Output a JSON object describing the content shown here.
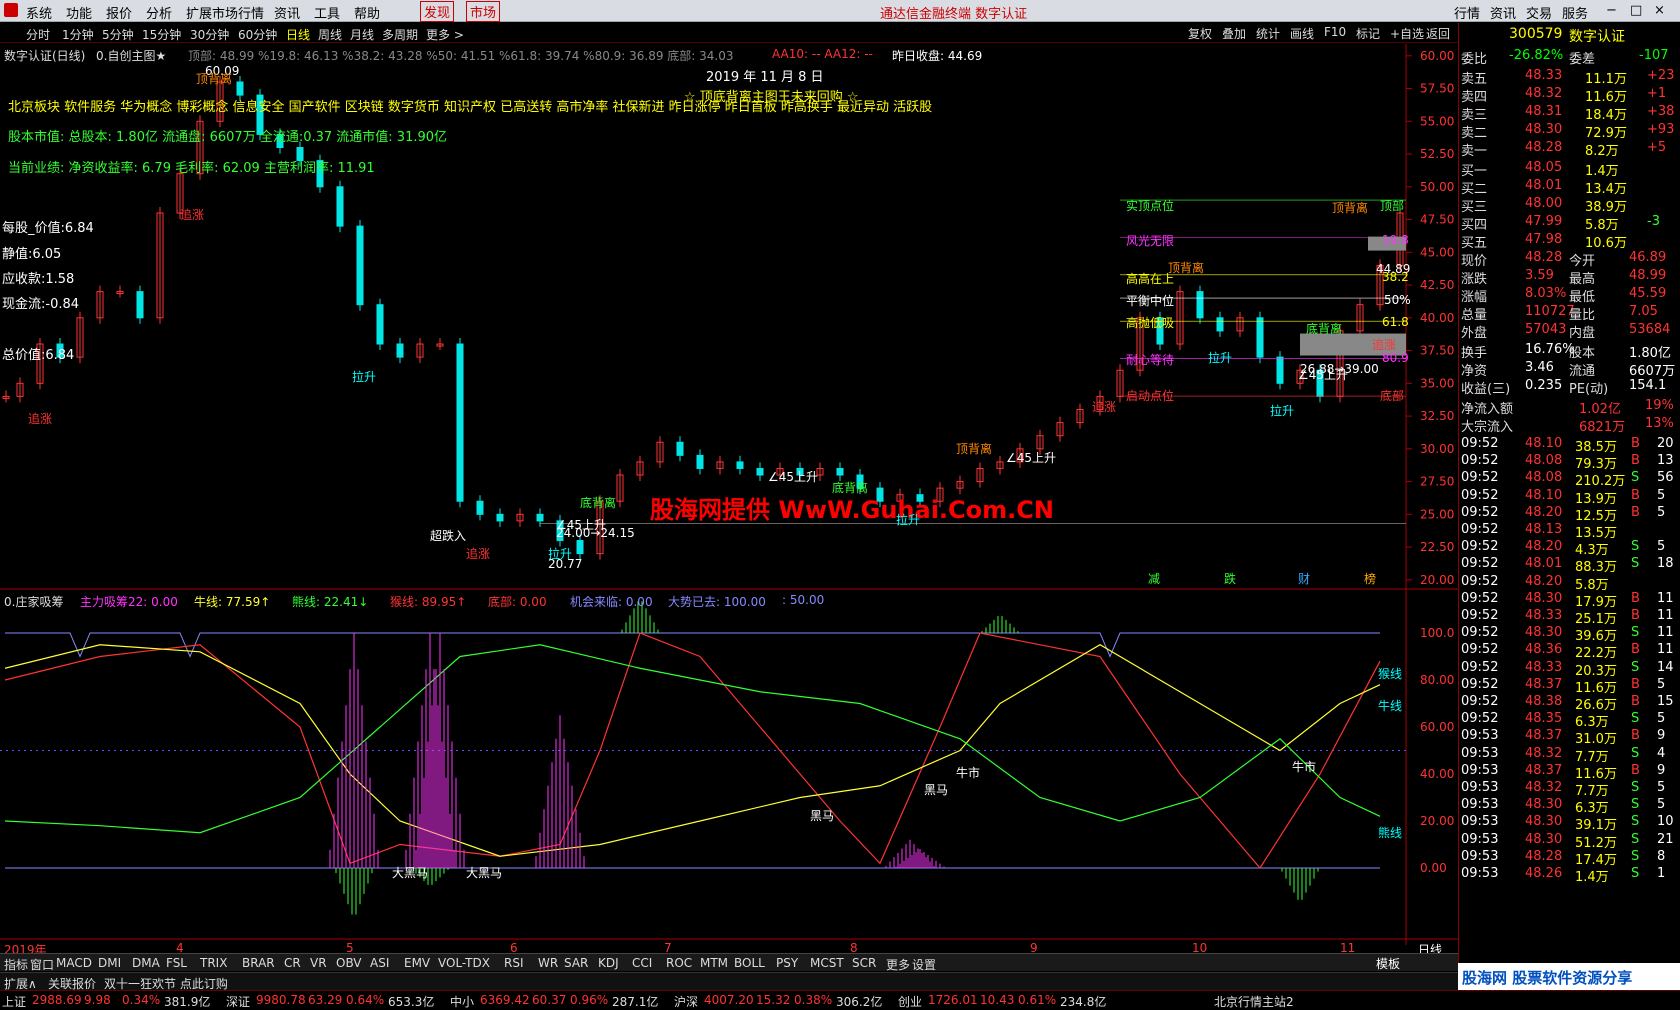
{
  "menu": {
    "items": [
      "系统",
      "功能",
      "报价",
      "分析",
      "扩展市场行情",
      "资讯",
      "工具",
      "帮助"
    ],
    "discover": "发现",
    "market": "市场",
    "center_text": "通达信金融终端  数字认证",
    "right": [
      "行情",
      "资讯",
      "交易",
      "服务"
    ]
  },
  "periods": [
    "分时",
    "1分钟",
    "5分钟",
    "15分钟",
    "30分钟",
    "60分钟",
    "日线",
    "周线",
    "月线",
    "多周期",
    "更多 >"
  ],
  "right_tools": [
    "复权",
    "叠加",
    "统计",
    "画线",
    "F10",
    "标记",
    "+自选",
    "返回"
  ],
  "main_title": "数字认证(日线)",
  "indicator_name": "0.自创主图★",
  "indicator_values": "顶部: 48.99  %19.8: 46.13  %38.2: 43.28  %50: 41.51  %61.8: 39.74  %80.9: 36.89  底部: 34.03",
  "aa_values": "AA10: -- AA12: --",
  "prev_close": "昨日收盘: 44.69",
  "overlay": {
    "date": "2019 年 11 月 8 日",
    "banner": "☆ 顶底背离主图王未来回购 ☆",
    "concepts": "北京板块 软件服务 华为概念 博彩概念 信息安全 国产软件 区块链 数字货币 知识产权 已高送转 高市净率 社保新进 昨日涨停 昨日首板 昨高换手 最近异动 活跃股",
    "capital": "股本市值: 总股本: 1.80亿 流通盘: 6607万 全流通:0.37 流通市值: 31.90亿",
    "perf": "当前业绩:  净资收益率: 6.79 毛利率: 62.09 主营利润率: 11.91",
    "left_vals": [
      "每股_价值:6.84",
      "静值:6.05",
      "应收款:1.58",
      "现金流:-0.84",
      "总价值:6.84"
    ],
    "watermark": "股海网提供 WwW.Guhai.Com.CN",
    "labels_right": [
      "实顶点位",
      "风光无限",
      "高高在上",
      "平衡中位",
      "高抛低吸",
      "耐心等待",
      "启动点位"
    ],
    "right_marks": [
      "顶部",
      "19.8",
      "38.2",
      "50%",
      "61.8",
      "80.9",
      "底部"
    ],
    "price_labels": [
      "60.09",
      "20.77",
      "44.89"
    ]
  },
  "price_axis": [
    "60.00",
    "57.50",
    "55.00",
    "52.50",
    "50.00",
    "47.50",
    "45.00",
    "42.50",
    "40.00",
    "37.50",
    "35.00",
    "32.50",
    "30.00",
    "27.50",
    "25.00",
    "22.50",
    "20.00"
  ],
  "chart_labels": {
    "zhuizhang": "追涨",
    "dibeili": "底背离",
    "dingbeili": "顶背离",
    "lasheng": "拉升",
    "shang45": "∠45上升",
    "range1": "24.00→24.15",
    "range2": "26.88→39.00",
    "chaodie": "超跌入",
    "jian": "减",
    "die": "跌",
    "cai": "财",
    "bang": "榜"
  },
  "sub": {
    "title": "0.庄家吸筹",
    "vals": [
      {
        "t": "主力吸筹22: 0.00",
        "c": "#ff33ff"
      },
      {
        "t": "牛线: 77.59↑",
        "c": "#ffff33"
      },
      {
        "t": "熊线: 22.41↓",
        "c": "#33ff33"
      },
      {
        "t": "猴线: 89.95↑",
        "c": "#ff3333"
      },
      {
        "t": "底部: 0.00",
        "c": "#ff3333"
      },
      {
        "t": "机会来临: 0.00",
        "c": "#8888ff"
      },
      {
        "t": "大势已去: 100.00",
        "c": "#8888ff"
      },
      {
        "t": ": 50.00",
        "c": "#8888ff"
      }
    ],
    "axis": [
      "100.0",
      "80.00",
      "60.00",
      "40.00",
      "20.00",
      "0.00"
    ],
    "line_labels": [
      "猴线",
      "牛线",
      "熊线"
    ],
    "marks": [
      "大黑马",
      "大黑马",
      "黑马",
      "黑马",
      "牛市",
      "牛市"
    ]
  },
  "xaxis": [
    "2019年",
    "4",
    "5",
    "6",
    "7",
    "8",
    "9",
    "10",
    "11",
    "日线"
  ],
  "tabs": [
    "指标",
    "窗口",
    "MACD",
    "DMI",
    "DMA",
    "FSL",
    "TRIX",
    "BRAR",
    "CR",
    "VR",
    "OBV",
    "ASI",
    "EMV",
    "VOL-TDX",
    "RSI",
    "WR",
    "SAR",
    "KDJ",
    "CCI",
    "ROC",
    "MTM",
    "BOLL",
    "PSY",
    "MCST",
    "SCR",
    "更多",
    "设置"
  ],
  "tabs2": [
    "扩展∧",
    "关联报价",
    "双十一狂欢节 点此订购"
  ],
  "tmpl": "模板",
  "quote": {
    "code": "300579",
    "name": "数字认证",
    "wb": {
      "l": "委比",
      "v": "-26.82%",
      "l2": "委差",
      "v2": "-107"
    },
    "sells": [
      [
        "卖五",
        "48.33",
        "11.1万",
        "+23"
      ],
      [
        "卖四",
        "48.32",
        "11.6万",
        "+1"
      ],
      [
        "卖三",
        "48.31",
        "18.4万",
        "+38"
      ],
      [
        "卖二",
        "48.30",
        "72.9万",
        "+93"
      ],
      [
        "卖一",
        "48.28",
        "8.2万",
        "+5"
      ]
    ],
    "buys": [
      [
        "买一",
        "48.05",
        "1.4万",
        ""
      ],
      [
        "买二",
        "48.01",
        "13.4万",
        ""
      ],
      [
        "买三",
        "48.00",
        "38.9万",
        ""
      ],
      [
        "买四",
        "47.99",
        "5.8万",
        "-3"
      ],
      [
        "买五",
        "47.98",
        "10.6万",
        ""
      ]
    ],
    "stats": [
      [
        "现价",
        "48.28",
        "今开",
        "46.89"
      ],
      [
        "涨跌",
        "3.59",
        "最高",
        "48.99"
      ],
      [
        "涨幅",
        "8.03%",
        "最低",
        "45.59"
      ],
      [
        "总量",
        "110727",
        "量比",
        "7.05"
      ],
      [
        "外盘",
        "57043",
        "内盘",
        "53684"
      ]
    ],
    "stats2": [
      [
        "换手",
        "16.76%",
        "股本",
        "1.80亿"
      ],
      [
        "净资",
        "3.46",
        "流通",
        "6607万"
      ],
      [
        "收益(三)",
        "0.235",
        "PE(动)",
        "154.1"
      ]
    ],
    "flows": [
      [
        "净流入额",
        "1.02亿",
        "19%"
      ],
      [
        "大宗流入",
        "6821万",
        "13%"
      ]
    ],
    "ticks": [
      [
        "09:52",
        "48.10",
        "38.5万",
        "B",
        "20"
      ],
      [
        "09:52",
        "48.08",
        "79.3万",
        "B",
        "13"
      ],
      [
        "09:52",
        "48.08",
        "210.2万",
        "S",
        "56"
      ],
      [
        "09:52",
        "48.10",
        "13.9万",
        "B",
        "5"
      ],
      [
        "09:52",
        "48.20",
        "12.5万",
        "B",
        "5"
      ],
      [
        "09:52",
        "48.13",
        "13.5万",
        "",
        ""
      ],
      [
        "09:52",
        "48.20",
        "4.3万",
        "S",
        "5"
      ],
      [
        "09:52",
        "48.01",
        "88.3万",
        "S",
        "18"
      ],
      [
        "09:52",
        "48.20",
        "5.8万",
        "",
        ""
      ],
      [
        "09:52",
        "48.30",
        "17.9万",
        "B",
        "11"
      ],
      [
        "09:52",
        "48.33",
        "25.1万",
        "B",
        "11"
      ],
      [
        "09:52",
        "48.30",
        "39.6万",
        "S",
        "11"
      ],
      [
        "09:52",
        "48.36",
        "22.2万",
        "B",
        "11"
      ],
      [
        "09:52",
        "48.33",
        "20.3万",
        "S",
        "14"
      ],
      [
        "09:52",
        "48.37",
        "11.6万",
        "B",
        "5"
      ],
      [
        "09:52",
        "48.38",
        "26.6万",
        "B",
        "15"
      ],
      [
        "09:52",
        "48.35",
        "6.3万",
        "S",
        "5"
      ],
      [
        "09:53",
        "48.37",
        "31.0万",
        "B",
        "9"
      ],
      [
        "09:53",
        "48.32",
        "7.7万",
        "S",
        "4"
      ],
      [
        "09:53",
        "48.37",
        "11.6万",
        "B",
        "9"
      ],
      [
        "09:53",
        "48.32",
        "7.7万",
        "S",
        "5"
      ],
      [
        "09:53",
        "48.30",
        "6.3万",
        "S",
        "5"
      ],
      [
        "09:53",
        "48.30",
        "39.1万",
        "S",
        "10"
      ],
      [
        "09:53",
        "48.30",
        "51.2万",
        "S",
        "21"
      ],
      [
        "09:53",
        "48.28",
        "17.4万",
        "S",
        "8"
      ],
      [
        "09:53",
        "48.26",
        "1.4万",
        "S",
        "1"
      ]
    ]
  },
  "bottom_banner": "股海网  股票软件资源分享",
  "status": [
    {
      "n": "上证",
      "p": "2988.69",
      "c": "9.98",
      "r": "0.34%",
      "v": "381.9亿"
    },
    {
      "n": "深证",
      "p": "9980.78",
      "c": "63.29",
      "r": "0.64%",
      "v": "653.3亿"
    },
    {
      "n": "中小",
      "p": "6369.42",
      "c": "60.37",
      "r": "0.96%",
      "v": "287.1亿"
    },
    {
      "n": "沪深",
      "p": "4007.20",
      "c": "15.32",
      "r": "0.38%",
      "v": "306.2亿"
    },
    {
      "n": "创业",
      "p": "1726.01",
      "c": "10.43",
      "r": "0.61%",
      "v": "234.8亿"
    }
  ],
  "status_right": "北京行情主站2",
  "colors": {
    "up": "#ff3333",
    "down": "#00ffff",
    "bg": "#000000"
  }
}
